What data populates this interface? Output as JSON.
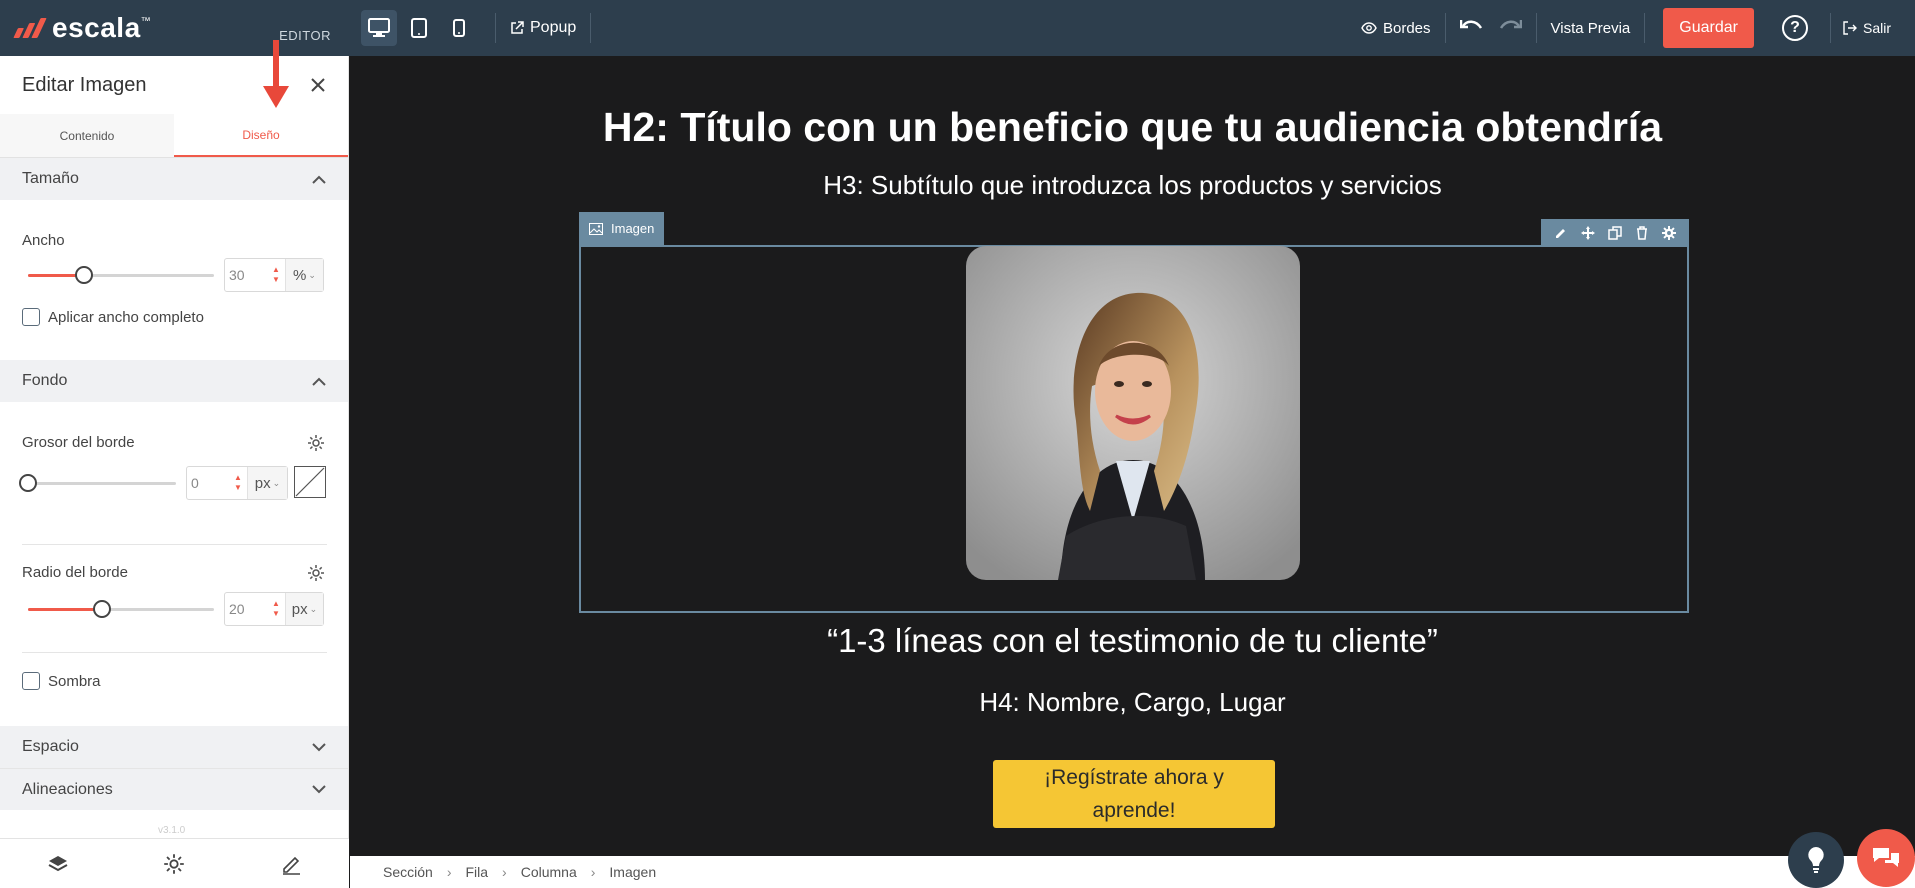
{
  "topbar": {
    "brand": "escala",
    "brand_tm": "™",
    "editor_tag": "EDITOR",
    "popup_label": "Popup",
    "bordes_label": "Bordes",
    "vista_previa_label": "Vista Previa",
    "guardar_label": "Guardar",
    "help_label": "?",
    "salir_label": "Salir"
  },
  "panel": {
    "title": "Editar Imagen",
    "tabs": [
      {
        "label": "Contenido",
        "active": false
      },
      {
        "label": "Diseño",
        "active": true
      }
    ],
    "sections": {
      "tamano": "Tamaño",
      "fondo": "Fondo",
      "espacio": "Espacio",
      "alineaciones": "Alineaciones"
    },
    "ancho": {
      "label": "Ancho",
      "value": "30",
      "unit": "%",
      "percent": 30
    },
    "aplicar_ancho": "Aplicar ancho completo",
    "grosor": {
      "label": "Grosor del borde",
      "value": "0",
      "unit": "px",
      "percent": 0
    },
    "radio": {
      "label": "Radio del borde",
      "value": "20",
      "unit": "px",
      "percent": 40
    },
    "sombra": "Sombra",
    "version": "v3.1.0"
  },
  "canvas": {
    "h2": "H2: Título con un beneficio que tu audiencia obtendría",
    "h3": "H3: Subtítulo que introduzca los productos y servicios",
    "image_tag": "Imagen",
    "quote": "“1-3 líneas con el testimonio de tu cliente”",
    "h4": "H4: Nombre, Cargo, Lugar",
    "cta": "¡Regístrate ahora y aprende!"
  },
  "breadcrumbs": [
    "Sección",
    "Fila",
    "Columna",
    "Imagen"
  ],
  "colors": {
    "accent": "#f05a4a",
    "topbar": "#2d3e4d",
    "canvas_bg": "#1b1b1c",
    "cta_bg": "#f5c634",
    "selection": "#6a8aa0"
  }
}
